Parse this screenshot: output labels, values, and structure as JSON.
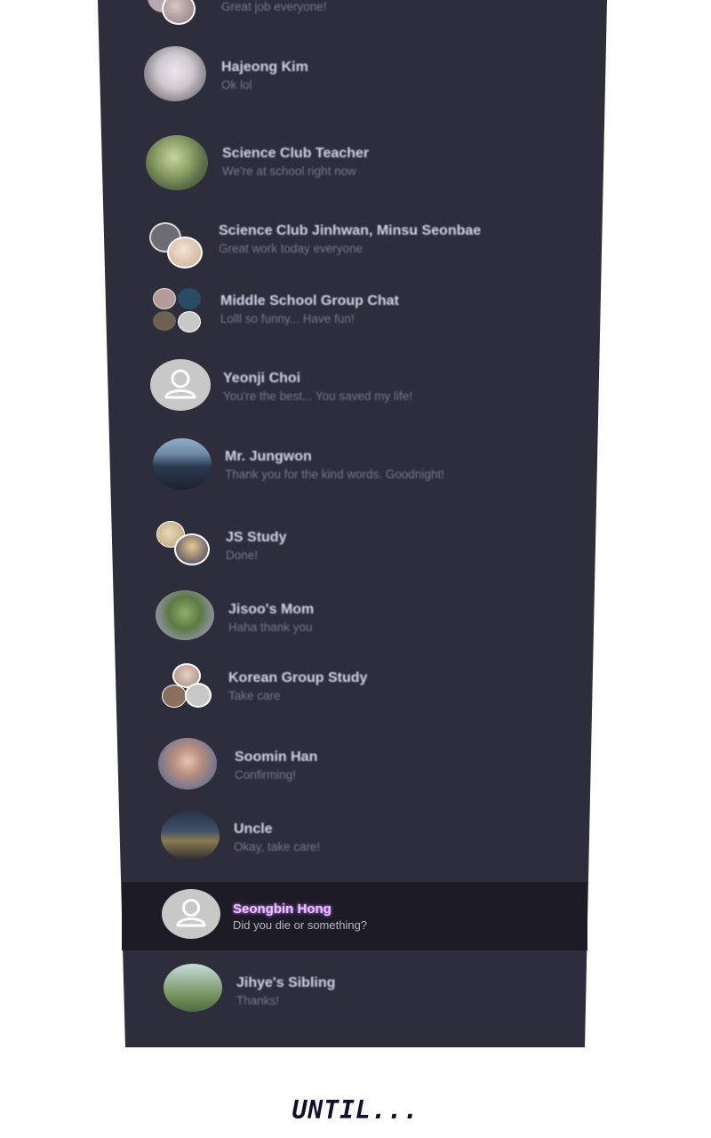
{
  "chat_list": {
    "items": [
      {
        "name": "",
        "message": "Great job everyone!"
      },
      {
        "name": "Hajeong Kim",
        "message": "Ok lol"
      },
      {
        "name": "Science Club Teacher",
        "message": "We're at school right now"
      },
      {
        "name": "Science Club Jinhwan, Minsu Seonbae",
        "message": "Great work today everyone"
      },
      {
        "name": "Middle School Group Chat",
        "message": "Lolll so funny... Have fun!"
      },
      {
        "name": "Yeonji Choi",
        "message": "You're the best... You saved my life!"
      },
      {
        "name": "Mr. Jungwon",
        "message": "Thank you for the kind words. Goodnight!"
      },
      {
        "name": "JS Study",
        "message": "Done!"
      },
      {
        "name": "Jisoo's Mom",
        "message": "Haha thank you"
      },
      {
        "name": "Korean Group Study",
        "message": "Take care"
      },
      {
        "name": "Soomin Han",
        "message": "Confirming!"
      },
      {
        "name": "Uncle",
        "message": "Okay, take care!"
      },
      {
        "name": "Seongbin Hong",
        "message": "Did you die or something?"
      },
      {
        "name": "Jihye's Sibling",
        "message": "Thanks!"
      }
    ]
  },
  "caption": "UNTIL...",
  "colors": {
    "panel": "#2e2d3b",
    "highlight_row": "#1c1b26",
    "highlight_name": "#e8c6ff",
    "default_avatar": "#c8c8c8"
  }
}
